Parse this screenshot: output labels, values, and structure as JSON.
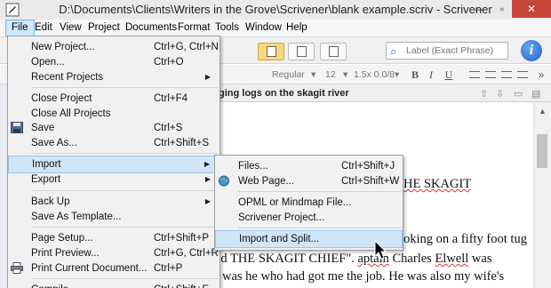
{
  "window": {
    "title": "D:\\Documents\\Clients\\Writers in the Grove\\Scrivener\\blank example.scriv - Scrivener",
    "minimize_glyph": "—",
    "maximize_glyph": "▫",
    "close_glyph": "✕"
  },
  "menubar": {
    "items": [
      "File",
      "Edit",
      "View",
      "Project",
      "Documents",
      "Format",
      "Tools",
      "Window",
      "Help"
    ]
  },
  "search": {
    "placeholder": "Label (Exact Phrase)"
  },
  "info_glyph": "i",
  "format": {
    "style": "Regular",
    "size": "12",
    "line_spacing": "1.5x 0.0/8",
    "bold": "B",
    "italic": "I",
    "underline": "U",
    "more": "»"
  },
  "editor": {
    "doc_title": "ging logs on the skagit river",
    "lines": {
      "l1_a": "HE SKAGIT",
      "l2_a": "oking on a fifty foot tug",
      "l3_a": "ed THE SKAGIT CHIEF\". ",
      "l3_b": "aptain",
      "l3_c": " Charles ",
      "l3_d": "Elwell",
      "l3_e": " was",
      "l4_a": "was he who had got me the job. He was also my wife's",
      "l5_a": "           ro     bb      f    th         Sk   it Ri       M  ll  "
    }
  },
  "file_menu": {
    "items": [
      {
        "label": "New Project...",
        "shortcut": "Ctrl+G, Ctrl+N"
      },
      {
        "label": "Open...",
        "shortcut": "Ctrl+O"
      },
      {
        "label": "Recent Projects",
        "shortcut": ""
      },
      {
        "label": "Close Project",
        "shortcut": "Ctrl+F4"
      },
      {
        "label": "Close All Projects",
        "shortcut": ""
      },
      {
        "label": "Save",
        "shortcut": "Ctrl+S"
      },
      {
        "label": "Save As...",
        "shortcut": "Ctrl+Shift+S"
      },
      {
        "label": "Import",
        "shortcut": ""
      },
      {
        "label": "Export",
        "shortcut": ""
      },
      {
        "label": "Back Up",
        "shortcut": ""
      },
      {
        "label": "Save As Template...",
        "shortcut": ""
      },
      {
        "label": "Page Setup...",
        "shortcut": "Ctrl+Shift+P"
      },
      {
        "label": "Print Preview...",
        "shortcut": "Ctrl+G, Ctrl+R"
      },
      {
        "label": "Print Current Document...",
        "shortcut": "Ctrl+P"
      },
      {
        "label": "Compile...",
        "shortcut": "Ctrl+Shift+E"
      }
    ]
  },
  "import_menu": {
    "items": [
      {
        "label": "Files...",
        "shortcut": "Ctrl+Shift+J"
      },
      {
        "label": "Web Page...",
        "shortcut": "Ctrl+Shift+W"
      },
      {
        "label": "OPML or Mindmap File...",
        "shortcut": ""
      },
      {
        "label": "Scrivener Project...",
        "shortcut": ""
      },
      {
        "label": "Import and Split...",
        "shortcut": ""
      }
    ]
  },
  "colors": {
    "menu_highlight": "#d1e5f8",
    "active_menu": "#cde8ff",
    "close_button": "#c7443b",
    "toolbar_selected": "#f6d87c"
  }
}
